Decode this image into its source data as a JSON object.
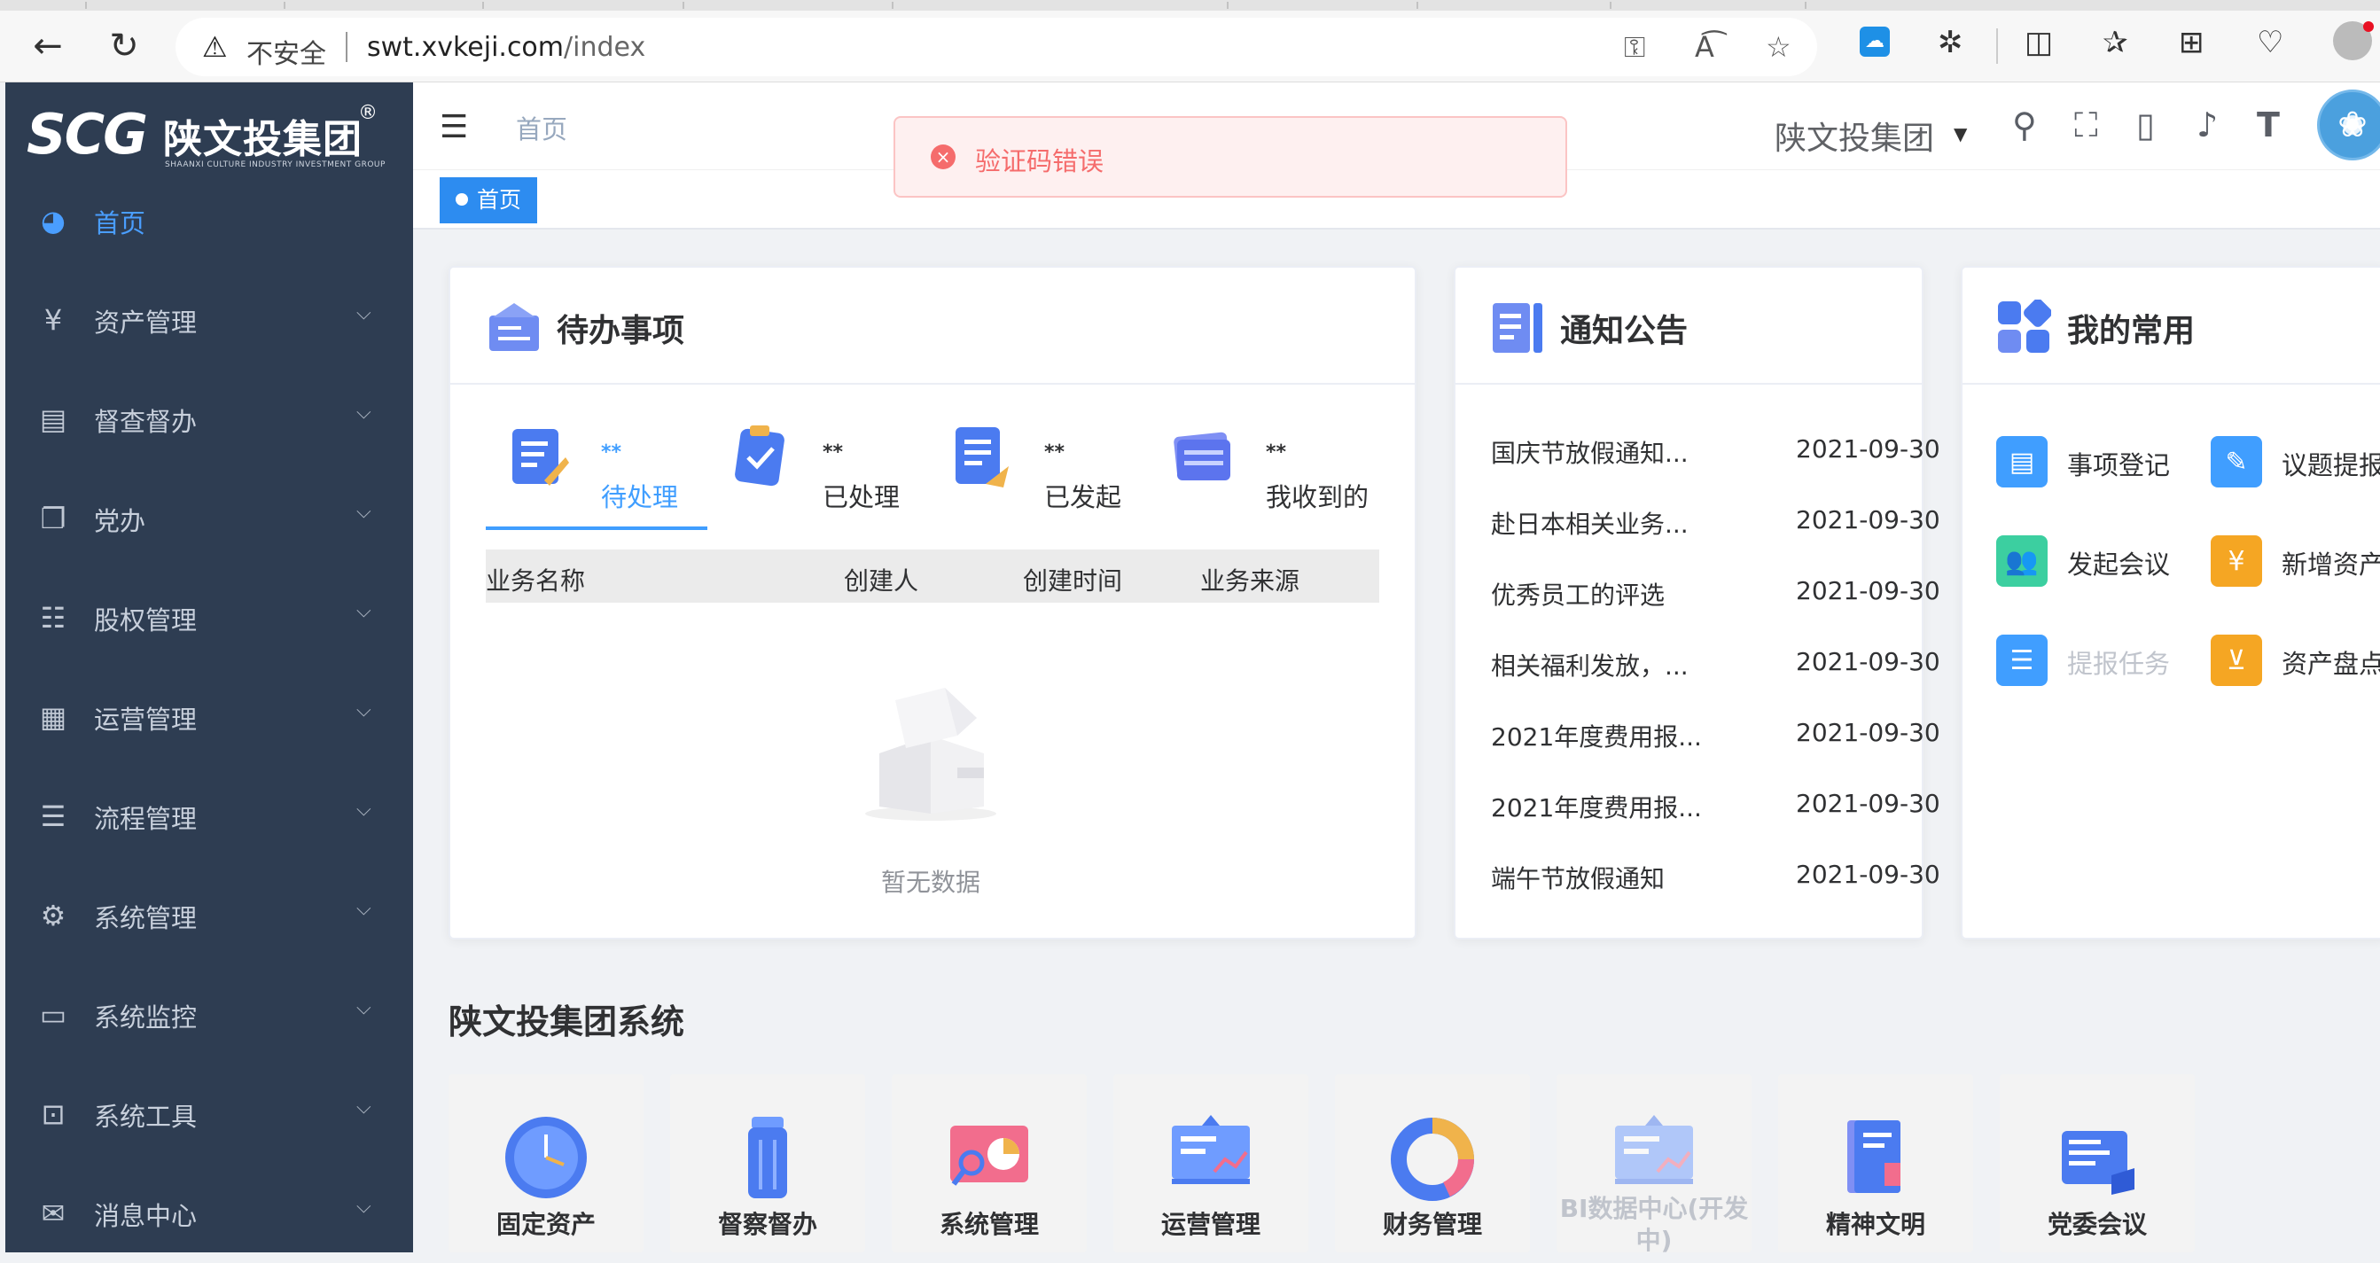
{
  "browser": {
    "security_label": "不安全",
    "url_host": "swt.xvkeji.com",
    "url_path": "/index"
  },
  "sidebar": {
    "logo_text": "SCG",
    "company_name": "陕文投集团",
    "company_en": "SHAANXI CULTURE INDUSTRY INVESTMENT GROUP",
    "reg_mark": "®",
    "items": [
      {
        "label": "首页",
        "icon": "dashboard-icon",
        "active": true
      },
      {
        "label": "资产管理",
        "icon": "yen-icon"
      },
      {
        "label": "督查督办",
        "icon": "clipboard-icon"
      },
      {
        "label": "党办",
        "icon": "copy-icon"
      },
      {
        "label": "股权管理",
        "icon": "tree-list-icon"
      },
      {
        "label": "运营管理",
        "icon": "grid-icon"
      },
      {
        "label": "流程管理",
        "icon": "sliders-icon"
      },
      {
        "label": "系统管理",
        "icon": "gear-icon"
      },
      {
        "label": "系统监控",
        "icon": "monitor-icon"
      },
      {
        "label": "系统工具",
        "icon": "toolbox-icon"
      },
      {
        "label": "消息中心",
        "icon": "mail-icon"
      }
    ]
  },
  "navbar": {
    "breadcrumb": "首页",
    "org_name": "陕文投集团"
  },
  "tags": {
    "active_tag": "首页"
  },
  "message": {
    "text": "验证码错误"
  },
  "todo": {
    "title": "待办事项",
    "tabs": [
      {
        "count": "**",
        "label": "待处理",
        "active": true
      },
      {
        "count": "**",
        "label": "已处理"
      },
      {
        "count": "**",
        "label": "已发起"
      },
      {
        "count": "**",
        "label": "我收到的"
      }
    ],
    "columns": [
      "业务名称",
      "创建人",
      "创建时间",
      "业务来源"
    ],
    "empty_text": "暂无数据"
  },
  "notices": {
    "title": "通知公告",
    "items": [
      {
        "title": "国庆节放假通知...",
        "date": "2021-09-30"
      },
      {
        "title": "赴日本相关业务...",
        "date": "2021-09-30"
      },
      {
        "title": "优秀员工的评选",
        "date": "2021-09-30"
      },
      {
        "title": "相关福利发放，...",
        "date": "2021-09-30"
      },
      {
        "title": "2021年度费用报...",
        "date": "2021-09-30"
      },
      {
        "title": "2021年度费用报...",
        "date": "2021-09-30"
      },
      {
        "title": "端午节放假通知",
        "date": "2021-09-30"
      }
    ]
  },
  "favorites": {
    "title": "我的常用",
    "items": [
      {
        "label": "事项登记",
        "color": "#409eff",
        "icon": "document-icon"
      },
      {
        "label": "议题提报",
        "color": "#409eff",
        "icon": "topic-icon"
      },
      {
        "label": "发起会议",
        "color": "#3ccfa0",
        "icon": "users-icon"
      },
      {
        "label": "新增资产",
        "color": "#f5a623",
        "icon": "coins-icon"
      },
      {
        "label": "提报任务",
        "color": "#409eff",
        "icon": "list-icon",
        "disabled": true
      },
      {
        "label": "资产盘点",
        "color": "#f5a623",
        "icon": "inbox-icon"
      }
    ]
  },
  "systems": {
    "title": "陕文投集团系统",
    "items": [
      {
        "label": "固定资产",
        "icon": "clock-icon"
      },
      {
        "label": "督察督办",
        "icon": "trash-can-icon"
      },
      {
        "label": "系统管理",
        "icon": "analytics-icon"
      },
      {
        "label": "运营管理",
        "icon": "board-chart-icon"
      },
      {
        "label": "财务管理",
        "icon": "donut-chart-icon"
      },
      {
        "label": "BI数据中心(开发中)",
        "icon": "board-chart-icon",
        "disabled": true
      },
      {
        "label": "精神文明",
        "icon": "book-icon"
      },
      {
        "label": "党委会议",
        "icon": "folder-icon"
      }
    ]
  },
  "colors": {
    "sidebar_bg": "#2e3d52",
    "accent": "#409eff",
    "error": "#f56c6c"
  }
}
